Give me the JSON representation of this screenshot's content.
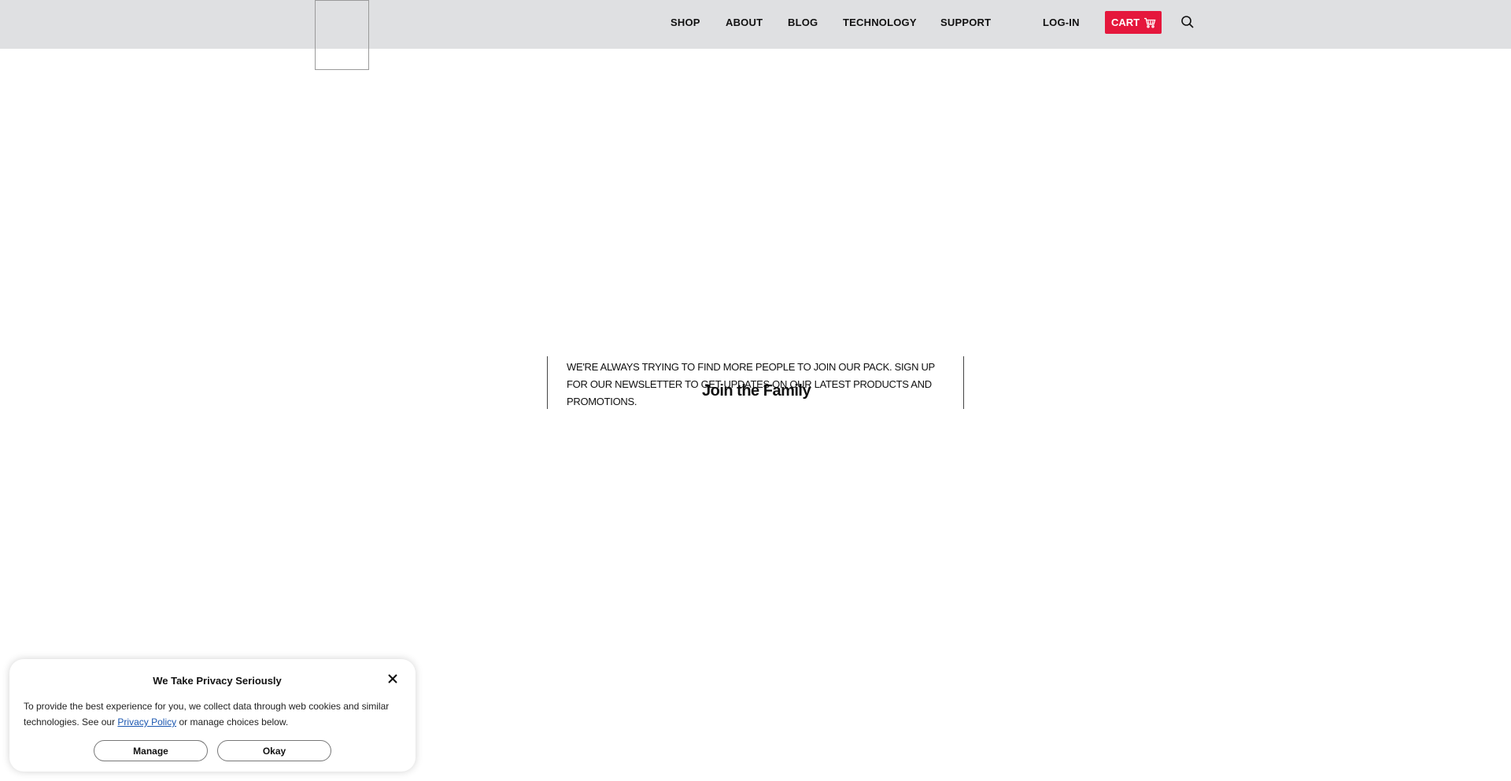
{
  "header": {
    "nav": {
      "shop": "SHOP",
      "about": "ABOUT",
      "blog": "BLOG",
      "technology": "TECHNOLOGY",
      "support": "SUPPORT",
      "login": "LOG-IN",
      "cart": "CART"
    },
    "icons": {
      "cart": "cart-icon",
      "search": "search-icon"
    },
    "cart_color": "#e5173c",
    "background_color": "#dfe0e2"
  },
  "newsletter": {
    "text": "We're always trying to find more people to join our pack. Sign up for our newsletter to get updates on our latest products and promotions.",
    "title": "Join the Family"
  },
  "privacy": {
    "title": "We Take Privacy Seriously",
    "body_before_link": "To provide the best experience for you, we collect data through web cookies and similar technologies. See our ",
    "link_text": "Privacy Policy",
    "body_after_link": " or manage choices below.",
    "manage_label": "Manage",
    "okay_label": "Okay",
    "close_icon": "close-icon",
    "link_color": "#1a56b0"
  }
}
